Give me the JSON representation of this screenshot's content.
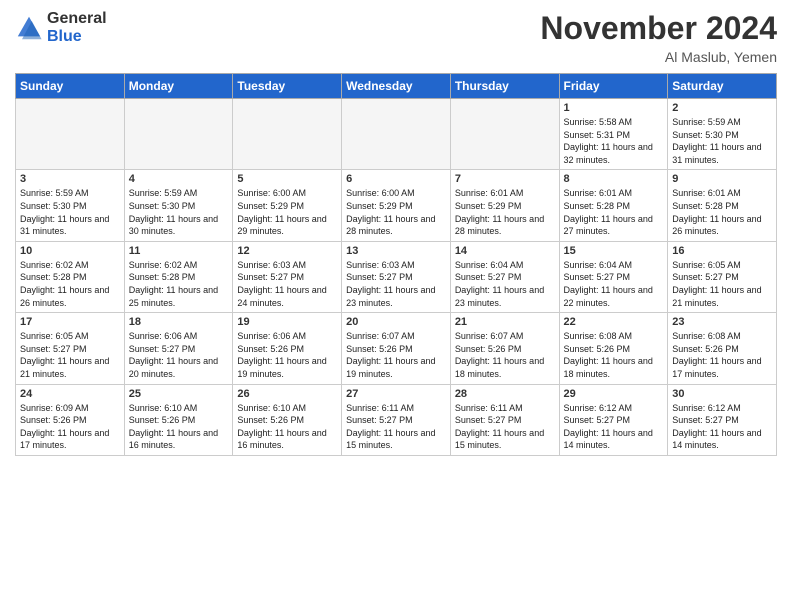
{
  "header": {
    "logo_general": "General",
    "logo_blue": "Blue",
    "month_title": "November 2024",
    "location": "Al Maslub, Yemen"
  },
  "weekdays": [
    "Sunday",
    "Monday",
    "Tuesday",
    "Wednesday",
    "Thursday",
    "Friday",
    "Saturday"
  ],
  "weeks": [
    [
      {
        "day": "",
        "info": ""
      },
      {
        "day": "",
        "info": ""
      },
      {
        "day": "",
        "info": ""
      },
      {
        "day": "",
        "info": ""
      },
      {
        "day": "",
        "info": ""
      },
      {
        "day": "1",
        "info": "Sunrise: 5:58 AM\nSunset: 5:31 PM\nDaylight: 11 hours and 32 minutes."
      },
      {
        "day": "2",
        "info": "Sunrise: 5:59 AM\nSunset: 5:30 PM\nDaylight: 11 hours and 31 minutes."
      }
    ],
    [
      {
        "day": "3",
        "info": "Sunrise: 5:59 AM\nSunset: 5:30 PM\nDaylight: 11 hours and 31 minutes."
      },
      {
        "day": "4",
        "info": "Sunrise: 5:59 AM\nSunset: 5:30 PM\nDaylight: 11 hours and 30 minutes."
      },
      {
        "day": "5",
        "info": "Sunrise: 6:00 AM\nSunset: 5:29 PM\nDaylight: 11 hours and 29 minutes."
      },
      {
        "day": "6",
        "info": "Sunrise: 6:00 AM\nSunset: 5:29 PM\nDaylight: 11 hours and 28 minutes."
      },
      {
        "day": "7",
        "info": "Sunrise: 6:01 AM\nSunset: 5:29 PM\nDaylight: 11 hours and 28 minutes."
      },
      {
        "day": "8",
        "info": "Sunrise: 6:01 AM\nSunset: 5:28 PM\nDaylight: 11 hours and 27 minutes."
      },
      {
        "day": "9",
        "info": "Sunrise: 6:01 AM\nSunset: 5:28 PM\nDaylight: 11 hours and 26 minutes."
      }
    ],
    [
      {
        "day": "10",
        "info": "Sunrise: 6:02 AM\nSunset: 5:28 PM\nDaylight: 11 hours and 26 minutes."
      },
      {
        "day": "11",
        "info": "Sunrise: 6:02 AM\nSunset: 5:28 PM\nDaylight: 11 hours and 25 minutes."
      },
      {
        "day": "12",
        "info": "Sunrise: 6:03 AM\nSunset: 5:27 PM\nDaylight: 11 hours and 24 minutes."
      },
      {
        "day": "13",
        "info": "Sunrise: 6:03 AM\nSunset: 5:27 PM\nDaylight: 11 hours and 23 minutes."
      },
      {
        "day": "14",
        "info": "Sunrise: 6:04 AM\nSunset: 5:27 PM\nDaylight: 11 hours and 23 minutes."
      },
      {
        "day": "15",
        "info": "Sunrise: 6:04 AM\nSunset: 5:27 PM\nDaylight: 11 hours and 22 minutes."
      },
      {
        "day": "16",
        "info": "Sunrise: 6:05 AM\nSunset: 5:27 PM\nDaylight: 11 hours and 21 minutes."
      }
    ],
    [
      {
        "day": "17",
        "info": "Sunrise: 6:05 AM\nSunset: 5:27 PM\nDaylight: 11 hours and 21 minutes."
      },
      {
        "day": "18",
        "info": "Sunrise: 6:06 AM\nSunset: 5:27 PM\nDaylight: 11 hours and 20 minutes."
      },
      {
        "day": "19",
        "info": "Sunrise: 6:06 AM\nSunset: 5:26 PM\nDaylight: 11 hours and 19 minutes."
      },
      {
        "day": "20",
        "info": "Sunrise: 6:07 AM\nSunset: 5:26 PM\nDaylight: 11 hours and 19 minutes."
      },
      {
        "day": "21",
        "info": "Sunrise: 6:07 AM\nSunset: 5:26 PM\nDaylight: 11 hours and 18 minutes."
      },
      {
        "day": "22",
        "info": "Sunrise: 6:08 AM\nSunset: 5:26 PM\nDaylight: 11 hours and 18 minutes."
      },
      {
        "day": "23",
        "info": "Sunrise: 6:08 AM\nSunset: 5:26 PM\nDaylight: 11 hours and 17 minutes."
      }
    ],
    [
      {
        "day": "24",
        "info": "Sunrise: 6:09 AM\nSunset: 5:26 PM\nDaylight: 11 hours and 17 minutes."
      },
      {
        "day": "25",
        "info": "Sunrise: 6:10 AM\nSunset: 5:26 PM\nDaylight: 11 hours and 16 minutes."
      },
      {
        "day": "26",
        "info": "Sunrise: 6:10 AM\nSunset: 5:26 PM\nDaylight: 11 hours and 16 minutes."
      },
      {
        "day": "27",
        "info": "Sunrise: 6:11 AM\nSunset: 5:27 PM\nDaylight: 11 hours and 15 minutes."
      },
      {
        "day": "28",
        "info": "Sunrise: 6:11 AM\nSunset: 5:27 PM\nDaylight: 11 hours and 15 minutes."
      },
      {
        "day": "29",
        "info": "Sunrise: 6:12 AM\nSunset: 5:27 PM\nDaylight: 11 hours and 14 minutes."
      },
      {
        "day": "30",
        "info": "Sunrise: 6:12 AM\nSunset: 5:27 PM\nDaylight: 11 hours and 14 minutes."
      }
    ]
  ]
}
